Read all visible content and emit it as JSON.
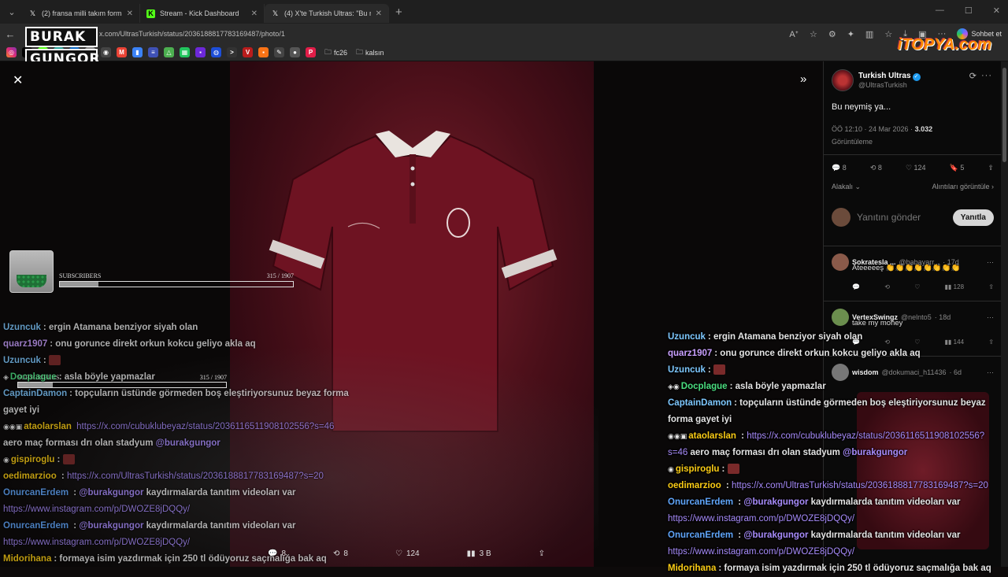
{
  "browser": {
    "tabs": [
      {
        "label": "(2) fransa milli takım forma - Aran",
        "favicon": "X",
        "active": false
      },
      {
        "label": "Stream - Kick Dashboard",
        "favicon": "K",
        "active": false
      },
      {
        "label": "(4) X'te Turkish Ultras: \"Bu neymiş",
        "favicon": "X",
        "active": true
      }
    ],
    "url": "x.com/UltrasTurkish/status/2036188817783169487/photo/1",
    "chat_button": "Sohbet et",
    "bookmarks": [
      "fc26",
      "kalsın"
    ]
  },
  "overlay": {
    "logo_line1": "BURAK",
    "logo_line2": "GUNGOR",
    "watermark": "iTOPYA.com",
    "sub_goal": {
      "label": "SUBSCRIBERS",
      "count": "315 / 1907",
      "progress": 0.165
    }
  },
  "viewer": {
    "actions": {
      "replies": "8",
      "reposts": "8",
      "likes": "124",
      "views": "3 B"
    }
  },
  "tweet": {
    "name": "Turkish Ultras",
    "handle": "@UltrasTurkish",
    "text": "Bu neymiş ya...",
    "time": "ÖÖ 12:10 · 24 Mar 2026 · ",
    "views_count": "3.032",
    "views_label": "Görüntüleme",
    "stats": {
      "replies": "8",
      "reposts": "8",
      "likes": "124",
      "bookmarks": "5"
    },
    "related": "Alakalı",
    "quotes": "Alıntıları görüntüle",
    "reply_placeholder": "Yanıtını gönder",
    "reply_button": "Yanıtla",
    "replies": [
      {
        "name": "Sokratesla ...",
        "handle": "@babayarr...",
        "time": "· 17d",
        "text": "Ateeeeeş 👏👏👏👏👏👏👏👏",
        "views": "128"
      },
      {
        "name": "VertexSwingz",
        "handle": "@nelnto5",
        "time": "· 18d",
        "text": "take my money",
        "views": "144"
      },
      {
        "name": "wisdom",
        "handle": "@dokumaci_h11436",
        "time": "· 6d",
        "text": "",
        "views": ""
      }
    ]
  },
  "chat_left": [
    {
      "user": "Uzuncuk",
      "text": ": ergin Atamana benziyor siyah olan",
      "color": "#7ec8ff"
    },
    {
      "user": "quarz1907",
      "text": ": onu gorunce direkt orkun kokcu geliyo akla aq",
      "color": "#c9a0ff"
    },
    {
      "user": "Uzuncuk",
      "text": ":",
      "color": "#7ec8ff",
      "emote": true
    },
    {
      "user": "Docplague",
      "text": ": asla böyle yapmazlar",
      "color": "#4ade80"
    },
    {
      "user": "CaptainDamon",
      "text": ": topçuların üstünde görmeden boş eleştiriyorsunuz beyaz forma gayet iyi",
      "color": "#7ec8ff"
    },
    {
      "user": "ataolarslan",
      "text": "",
      "link": "https://x.com/cubuklubeyaz/status/2036116511908102556?s=46",
      "tail": " aero maç forması drı olan stadyum ",
      "mention": "@burakgungor",
      "color": "#facc15"
    },
    {
      "user": "gispiroglu",
      "text": ":",
      "color": "#facc15",
      "emote": true
    },
    {
      "user": "oedimarzioo",
      "text": "",
      "link": "https://x.com/UltrasTurkish/status/2036188817783169487?s=20",
      "color": "#facc15"
    },
    {
      "user": "OnurcanErdem",
      "text": "",
      "mention": "@burakgungor",
      "tail": " kaydırmalarda tanıtım videoları var",
      "link2": "https://www.instagram.com/p/DWOZE8jDQQy/",
      "color": "#60a5fa"
    },
    {
      "user": "OnurcanErdem",
      "text": "",
      "mention": "@burakgungor",
      "tail": " kaydırmalarda tanıtım videoları var",
      "link2": "https://www.instagram.com/p/DWOZE8jDQQy/",
      "color": "#60a5fa"
    },
    {
      "user": "Midorihana",
      "text": ": formaya isim yazdırmak için 250 tl ödüyoruz saçmalığa bak aq",
      "color": "#facc15"
    }
  ]
}
